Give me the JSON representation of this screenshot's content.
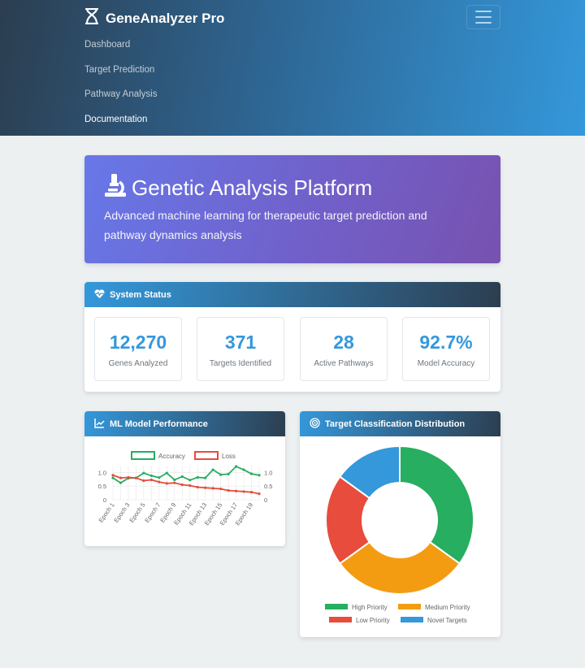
{
  "navbar": {
    "brand": "GeneAnalyzer Pro",
    "links": [
      "Dashboard",
      "Target Prediction",
      "Pathway Analysis",
      "Documentation"
    ]
  },
  "hero": {
    "title": "Genetic Analysis Platform",
    "subtitle": "Advanced machine learning for therapeutic target prediction and pathway dynamics analysis"
  },
  "status": {
    "title": "System Status",
    "stats": [
      {
        "value": "12,270",
        "label": "Genes Analyzed"
      },
      {
        "value": "371",
        "label": "Targets Identified"
      },
      {
        "value": "28",
        "label": "Active Pathways"
      },
      {
        "value": "92.7%",
        "label": "Model Accuracy"
      }
    ]
  },
  "perf": {
    "title": "ML Model Performance"
  },
  "classification": {
    "title": "Target Classification Distribution"
  },
  "colors": {
    "accent": "#3498db",
    "accuracy": "#27ae60",
    "loss": "#e74c3c",
    "high": "#27ae60",
    "medium": "#f39c12",
    "low": "#e74c3c",
    "novel": "#3498db"
  },
  "chart_data": [
    {
      "type": "line",
      "x": [
        "Epoch 1",
        "Epoch 2",
        "Epoch 3",
        "Epoch 4",
        "Epoch 5",
        "Epoch 6",
        "Epoch 7",
        "Epoch 8",
        "Epoch 9",
        "Epoch 10",
        "Epoch 11",
        "Epoch 12",
        "Epoch 13",
        "Epoch 14",
        "Epoch 15",
        "Epoch 16",
        "Epoch 17",
        "Epoch 18",
        "Epoch 19",
        "Epoch 20"
      ],
      "xtick_labels": [
        "Epoch 1",
        "Epoch 3",
        "Epoch 5",
        "Epoch 7",
        "Epoch 9",
        "Epoch 11",
        "Epoch 13",
        "Epoch 15",
        "Epoch 17",
        "Epoch 19"
      ],
      "series": [
        {
          "name": "Accuracy",
          "axis": "left",
          "values": [
            0.8,
            0.62,
            0.79,
            0.8,
            0.98,
            0.88,
            0.81,
            0.98,
            0.73,
            0.85,
            0.72,
            0.82,
            0.8,
            1.1,
            0.92,
            0.94,
            1.22,
            1.1,
            0.95,
            0.9
          ]
        },
        {
          "name": "Loss",
          "axis": "right",
          "values": [
            0.9,
            0.8,
            0.82,
            0.8,
            0.7,
            0.73,
            0.65,
            0.6,
            0.62,
            0.55,
            0.52,
            0.46,
            0.44,
            0.42,
            0.4,
            0.34,
            0.32,
            0.3,
            0.28,
            0.22
          ]
        }
      ],
      "ylim": [
        0,
        1.25
      ],
      "yticks": [
        "1.0",
        "0.5",
        "0"
      ],
      "y2ticks": [
        "1.0",
        "0.5",
        "0"
      ],
      "legend": "top",
      "grid": true
    },
    {
      "type": "pie",
      "style": "doughnut",
      "categories": [
        "High Priority",
        "Medium Priority",
        "Low Priority",
        "Novel Targets"
      ],
      "values": [
        35,
        30,
        20,
        15
      ],
      "legend": "bottom"
    }
  ]
}
